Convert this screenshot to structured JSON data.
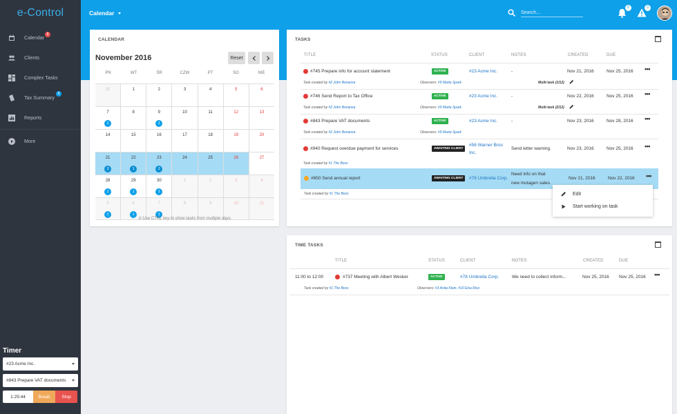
{
  "app": {
    "logo": "e-Control"
  },
  "sidebar": {
    "items": [
      {
        "label": "Calendar",
        "badge": "8",
        "badge_color": "#e9534f"
      },
      {
        "label": "Clients"
      },
      {
        "label": "Complex Tasks"
      },
      {
        "label": "Tax Summary",
        "badge": "8",
        "badge_color": "#0ea0e9"
      },
      {
        "label": "Reports"
      }
    ],
    "more": "More"
  },
  "timer": {
    "title": "Timer",
    "client": "#23 Acme Inc.",
    "task": "#843 Prepare VAT documents",
    "time": "1:25:44",
    "break_label": "Break",
    "stop_label": "Stop"
  },
  "header": {
    "page_selector": "Calendar",
    "search_placeholder": "Search...",
    "notifications_count": "0",
    "alerts_count": "0"
  },
  "calendar": {
    "title": "CALENDAR",
    "month": "November 2016",
    "reset_label": "Reset",
    "weekdays": [
      "PN",
      "WT",
      "ŚR",
      "CZW",
      "PT",
      "SO",
      "NIE"
    ],
    "weeks": [
      [
        {
          "d": "31",
          "o": true
        },
        {
          "d": "1"
        },
        {
          "d": "2"
        },
        {
          "d": "3"
        },
        {
          "d": "4"
        },
        {
          "d": "5",
          "w": true
        },
        {
          "d": "6",
          "w": true
        }
      ],
      [
        {
          "d": "7",
          "e": "1"
        },
        {
          "d": "8"
        },
        {
          "d": "9",
          "e": "1"
        },
        {
          "d": "10"
        },
        {
          "d": "11"
        },
        {
          "d": "12",
          "w": true
        },
        {
          "d": "13",
          "w": true
        }
      ],
      [
        {
          "d": "14"
        },
        {
          "d": "15"
        },
        {
          "d": "16"
        },
        {
          "d": "17"
        },
        {
          "d": "18"
        },
        {
          "d": "19",
          "w": true
        },
        {
          "d": "20",
          "w": true
        }
      ],
      [
        {
          "d": "21",
          "s": true,
          "e": "3"
        },
        {
          "d": "22",
          "s": true,
          "e": "1"
        },
        {
          "d": "23",
          "s": true,
          "e": "2"
        },
        {
          "d": "24",
          "s": true
        },
        {
          "d": "25",
          "s": true
        },
        {
          "d": "26",
          "s": true,
          "w": true
        },
        {
          "d": "27",
          "w": true
        }
      ],
      [
        {
          "d": "28",
          "e": "1"
        },
        {
          "d": "29",
          "e": "1"
        },
        {
          "d": "30",
          "e": "1"
        },
        {
          "d": "1",
          "o": true
        },
        {
          "d": "2",
          "o": true
        },
        {
          "d": "3",
          "o": true,
          "w": true
        },
        {
          "d": "4",
          "o": true,
          "w": true
        }
      ],
      [
        {
          "d": "5",
          "o": true,
          "e": "1"
        },
        {
          "d": "6",
          "o": true,
          "e": "1"
        },
        {
          "d": "7",
          "o": true,
          "e": "1"
        },
        {
          "d": "8",
          "o": true
        },
        {
          "d": "9",
          "o": true
        },
        {
          "d": "10",
          "o": true,
          "w": true
        },
        {
          "d": "11",
          "o": true,
          "w": true
        }
      ]
    ],
    "note": "Use CTRL key to show tasks from multiple days."
  },
  "tasks": {
    "title": "TASKS",
    "columns": {
      "title": "TITLE",
      "status": "STATUS",
      "client": "CLIENT",
      "notes": "NOTES",
      "created": "CREATED",
      "due": "DUE"
    },
    "rows": [
      {
        "title": "#745 Prepare info for account statement",
        "status": "ACTIVE",
        "client": "#23 Acme Inc.",
        "notes": "-",
        "created": "Nov 21, 2016",
        "due": "Nov 25, 2016",
        "created_by": "Task created by",
        "creator": "#2 John Bonanza",
        "observers_label": "Observers:",
        "observers": "#9 Marta Spark",
        "multi": "Multi-task (1/12)",
        "priority": "#e53935"
      },
      {
        "title": "#746 Send Report to Tax Office",
        "status": "ACTIVE",
        "client": "#23 Acme Inc.",
        "notes": "-",
        "created": "Nov 22, 2016",
        "due": "Nov 25, 2016",
        "created_by": "Task created by",
        "creator": "#2 John Bonanza",
        "observers_label": "Observers:",
        "observers": "#9 Marta Spark",
        "multi": "Multi-task (2/12)",
        "priority": "#e53935"
      },
      {
        "title": "#843 Prepare VAT documents",
        "status": "ACTIVE",
        "client": "#23 Acme Inc.",
        "notes": "-",
        "created": "Nov 23, 2016",
        "due": "Nov 28, 2016",
        "created_by": "Task created by",
        "creator": "#2 John Bonanza",
        "observers_label": "Observers:",
        "observers": "#9 Marta Spark",
        "priority": "#e53935"
      },
      {
        "title": "#940 Request overdue payment for services",
        "status": "AWAITING CLIENT",
        "client_line1": "#56 Warner Bros",
        "client_line2": "Inc.",
        "notes": "Send letter warning.",
        "created": "Nov 23, 2016",
        "due": "Nov 25, 2016",
        "created_by": "Task created by",
        "creator": "#1 The Boss",
        "priority": "#e53935"
      },
      {
        "title": "#650 Send annual report",
        "status": "AWAITING CLIENT",
        "client": "#78 Umbrella Corp.",
        "notes_line1": "Need info on that",
        "notes_line2": "new mutagen sales.",
        "created": "Nov 21, 2016",
        "due": "Nov 22, 2016",
        "created_by": "Task created by",
        "creator": "#1 The Boss",
        "priority": "#f5a623"
      }
    ],
    "menu": {
      "edit": "Edit",
      "start": "Start working on task"
    }
  },
  "time_tasks": {
    "title": "TIME TASKS",
    "columns": {
      "title": "TITLE",
      "status": "STATUS",
      "client": "CLIENT",
      "notes": "NOTES",
      "created": "CREATED",
      "due": "DUE"
    },
    "row": {
      "time": "11:00 to 12:00",
      "title": "#737 Meeting with Albert Wesker",
      "status": "ACTIVE",
      "client": "#78 Umbrella Corp.",
      "notes": "We need to collect inform...",
      "created": "Nov 25, 2016",
      "due": "Nov 25, 2016",
      "created_by": "Task created by",
      "creator": "#1 The Boss",
      "observers_label": "Observers:",
      "observers": "#3 Anita Klein, #10 Elsa Rice",
      "priority": "#e53935"
    }
  }
}
